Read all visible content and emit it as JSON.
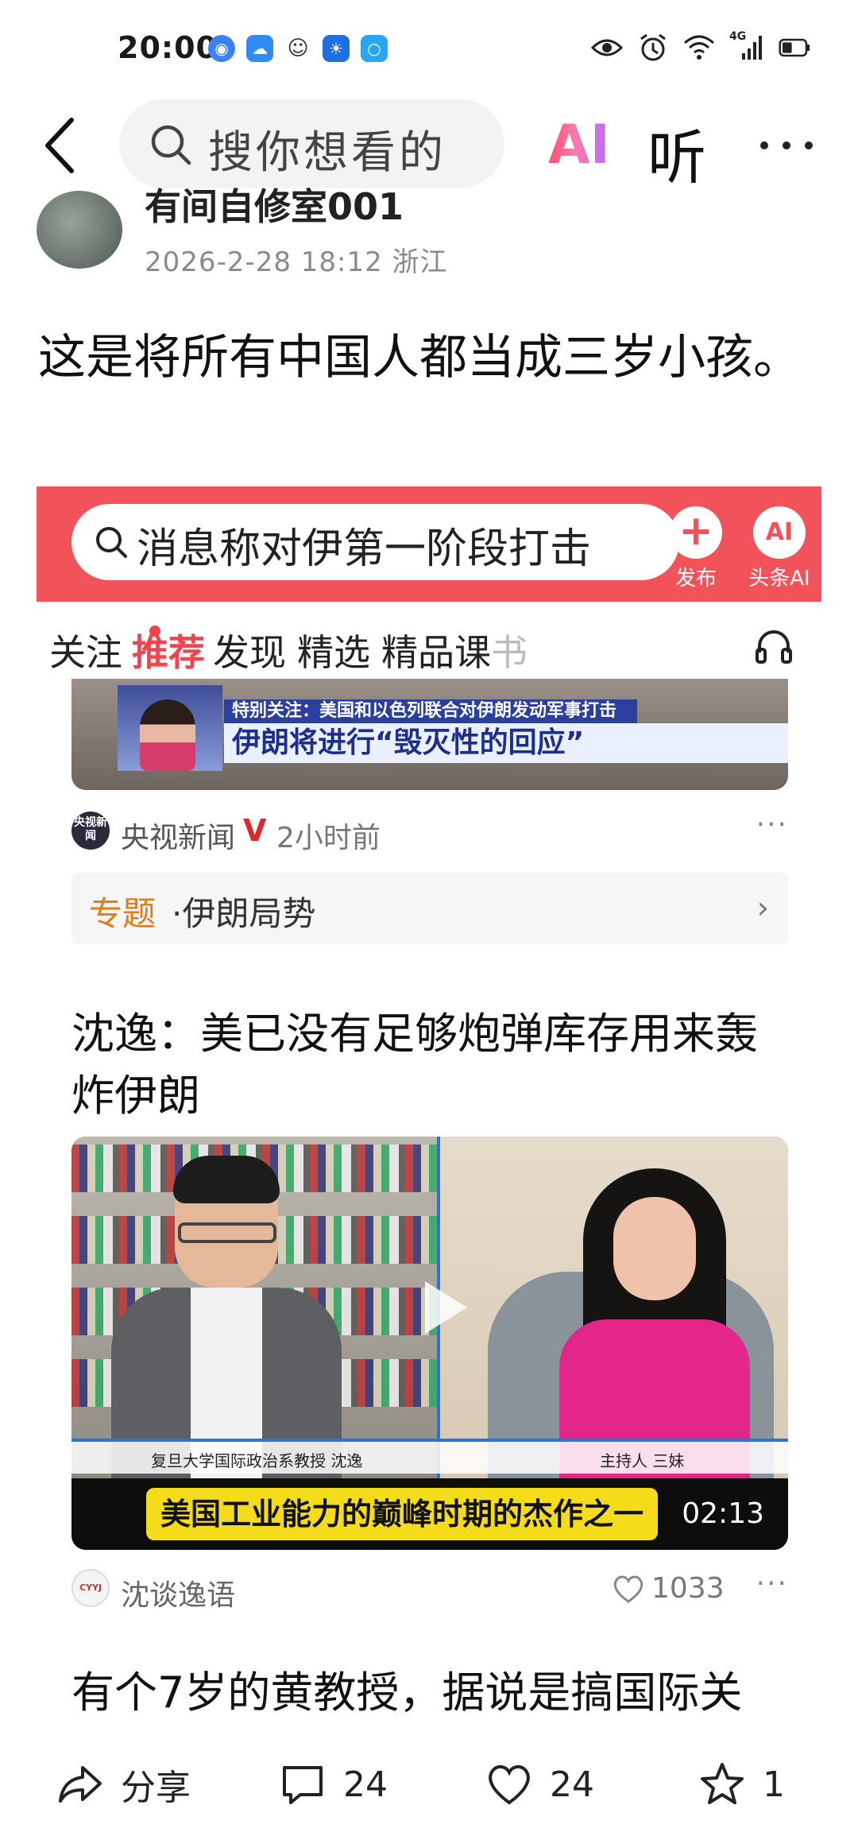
{
  "status_bar": {
    "time": "20:00",
    "network": "4G"
  },
  "top_nav": {
    "search_placeholder": "搜你想看的",
    "ai_label": "AI",
    "listen_label": "听"
  },
  "author": {
    "name": "有间自修室001",
    "meta": "2026-2-28 18:12 浙江"
  },
  "post": {
    "text": "这是将所有中国人都当成三岁小孩。"
  },
  "embedded_screenshot": {
    "search_text": "消息称对伊第一阶段打击",
    "publish_label": "发布",
    "ai_icon_label": "AI",
    "ai_label": "头条AI",
    "tabs": [
      "关注",
      "推荐",
      "发现",
      "精选",
      "精品课",
      "书"
    ],
    "news": {
      "banner_top": "特别关注：美国和以色列联合对伊朗发动军事打击",
      "banner_main": "伊朗将进行“毁灭性的回应”",
      "source_logo": "央视新闻",
      "source": "央视新闻",
      "verified": "V",
      "time": "2小时前",
      "more": "···"
    },
    "topic": {
      "label": "专题",
      "value": "·伊朗局势",
      "arrow": "›"
    },
    "article": {
      "title": "沈逸：美已没有足够炮弹库存用来轰炸伊朗",
      "caption_left": "复旦大学国际政治系教授 沈逸",
      "caption_right": "主持人 三妹",
      "subtitle": "美国工业能力的巅峰时期的杰作之一",
      "duration": "02:13",
      "source_logo": "CYYJ",
      "source": "沈谈逸语",
      "likes": "1033",
      "more": "···"
    }
  },
  "next_comment_preview": "有个7岁的黄教授，据说是搞国际关",
  "action_bar": {
    "share_label": "分享",
    "comments": "24",
    "likes": "24",
    "favorites": "1"
  }
}
